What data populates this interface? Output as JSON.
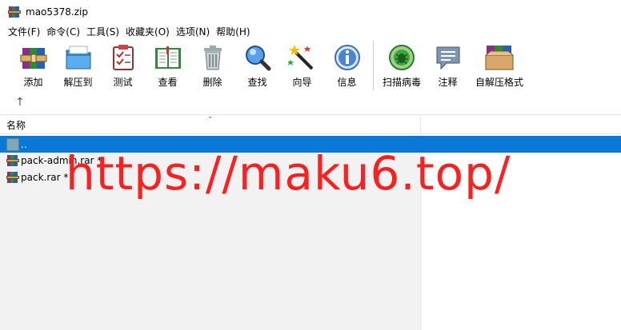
{
  "window": {
    "title": "mao5378.zip"
  },
  "menu": [
    "文件(F)",
    "命令(C)",
    "工具(S)",
    "收藏夹(O)",
    "选项(N)",
    "帮助(H)"
  ],
  "toolbar": [
    {
      "label": "添加",
      "icon": "add-archive-icon"
    },
    {
      "label": "解压到",
      "icon": "extract-to-icon"
    },
    {
      "label": "测试",
      "icon": "test-icon"
    },
    {
      "label": "查看",
      "icon": "view-book-icon"
    },
    {
      "label": "删除",
      "icon": "delete-trash-icon"
    },
    {
      "label": "查找",
      "icon": "find-magnifier-icon"
    },
    {
      "label": "向导",
      "icon": "wizard-wand-icon"
    },
    {
      "label": "信息",
      "icon": "info-icon"
    },
    {
      "label": "扫描病毒",
      "icon": "virus-scan-icon"
    },
    {
      "label": "注释",
      "icon": "comment-icon"
    },
    {
      "label": "自解压格式",
      "icon": "sfx-box-icon"
    }
  ],
  "list": {
    "column_name": "名称",
    "rows": [
      {
        "name": "..",
        "selected": true,
        "icon": "folder-up-icon"
      },
      {
        "name": "pack-admin.rar *",
        "selected": false,
        "icon": "rar-archive-icon"
      },
      {
        "name": "pack.rar *",
        "selected": false,
        "icon": "rar-archive-icon"
      }
    ]
  },
  "watermark": "https://maku6.top/",
  "colors": {
    "selection": "#0a78d7",
    "watermark": "#ff1f1f"
  }
}
